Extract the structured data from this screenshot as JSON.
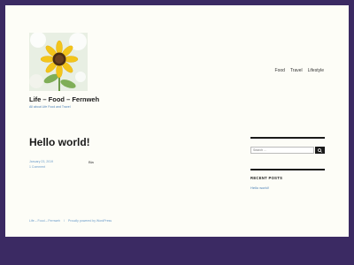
{
  "site": {
    "title": "Life – Food – Fernweh",
    "description": "All about Life Food and Travel"
  },
  "menu": {
    "items": [
      "Food",
      "Travel",
      "Lifestyle"
    ]
  },
  "post": {
    "title": "Hello world!",
    "date": "January 23, 2019",
    "comments": "1 Comment",
    "content": "Bla"
  },
  "sidebar": {
    "search_placeholder": "Search …",
    "recent_posts_title": "RECENT POSTS",
    "recent_posts": [
      "Hello world!"
    ]
  },
  "footer": {
    "site_link": "Life – Food – Fernweh",
    "separator": "/",
    "powered_by": "Proudly powered by WordPress"
  },
  "colors": {
    "outer_background": "#3b2a63",
    "page_background": "#fdfdf7",
    "link": "#4a7fb5",
    "text": "#1a1a1a"
  }
}
